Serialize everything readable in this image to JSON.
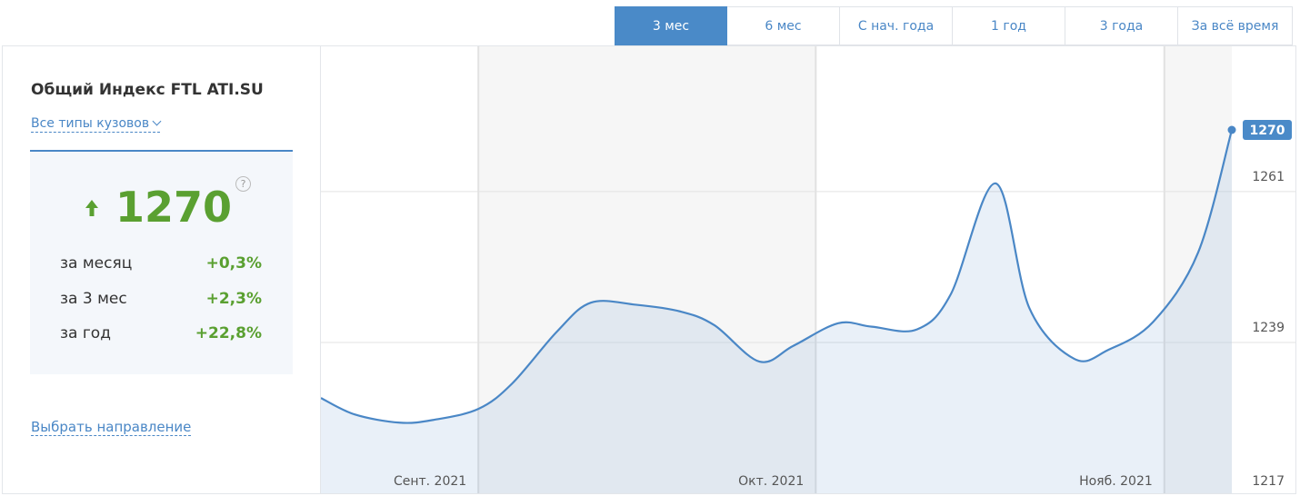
{
  "tabs": [
    {
      "label": "3 мес",
      "active": true
    },
    {
      "label": "6 мес",
      "active": false
    },
    {
      "label": "С нач. года",
      "active": false
    },
    {
      "label": "1 год",
      "active": false
    },
    {
      "label": "3 года",
      "active": false
    },
    {
      "label": "За всё время",
      "active": false
    }
  ],
  "panel": {
    "title": "Общий Индекс FTL ATI.SU",
    "body_type": "Все типы кузовов",
    "value": "1270",
    "help": "?",
    "stats": [
      {
        "label": "за месяц",
        "value": "+0,3%"
      },
      {
        "label": "за 3 мес",
        "value": "+2,3%"
      },
      {
        "label": "за год",
        "value": "+22,8%"
      }
    ],
    "route_link": "Выбрать направление"
  },
  "colors": {
    "accent": "#4a8ac8",
    "positive": "#5aa031",
    "line": "#4a87c6"
  },
  "chart_data": {
    "type": "area",
    "x": [
      "2021-08-18",
      "2021-08-21",
      "2021-08-25",
      "2021-08-28",
      "2021-09-01",
      "2021-09-04",
      "2021-09-08",
      "2021-09-11",
      "2021-09-15",
      "2021-09-19",
      "2021-09-22",
      "2021-09-26",
      "2021-09-29",
      "2021-10-03",
      "2021-10-06",
      "2021-10-10",
      "2021-10-13",
      "2021-10-17",
      "2021-10-20",
      "2021-10-24",
      "2021-10-27",
      "2021-10-31",
      "2021-11-04",
      "2021-11-07"
    ],
    "series": [
      {
        "values": [
          1230.9,
          1228.5,
          1227.3,
          1227.7,
          1229.3,
          1233,
          1240.6,
          1244.8,
          1244.5,
          1243.5,
          1241.5,
          1236.2,
          1238.5,
          1241.8,
          1241.3,
          1240.9,
          1246,
          1262.2,
          1244,
          1236.6,
          1237.9,
          1242,
          1252.1,
          1270
        ]
      }
    ],
    "x_tick_labels": [
      "Сент. 2021",
      "Окт. 2021",
      "Нояб. 2021"
    ],
    "y_ticks": [
      1217,
      1239,
      1261
    ],
    "last_value_label": "1270",
    "ylim": [
      1217,
      1270
    ]
  }
}
